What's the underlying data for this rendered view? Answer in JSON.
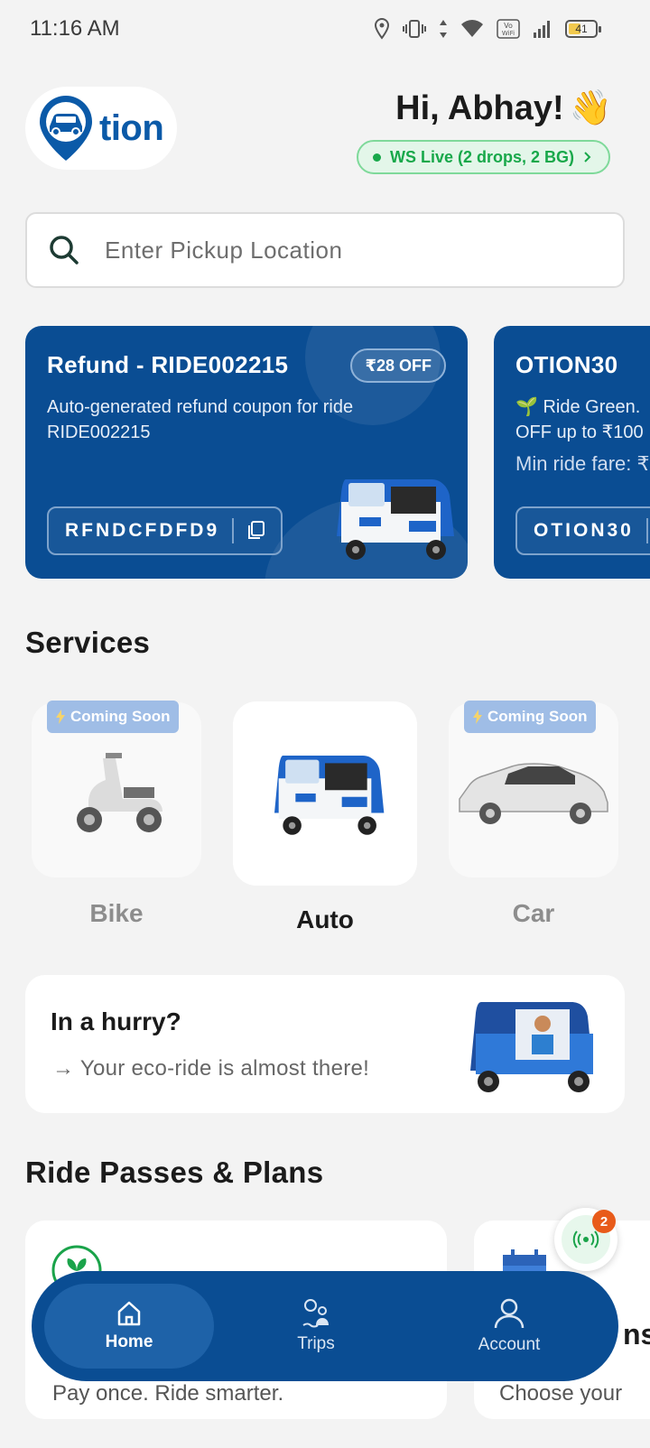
{
  "status_bar": {
    "time": "11:16 AM",
    "battery": "41"
  },
  "header": {
    "logo_text": "tion",
    "greeting": "Hi, Abhay!",
    "greeting_emoji": "👋",
    "ws_status": "WS Live (2 drops, 2 BG)"
  },
  "search": {
    "placeholder": "Enter Pickup Location"
  },
  "coupons": [
    {
      "title": "Refund - RIDE002215",
      "badge": "₹28 OFF",
      "description": "Auto-generated refund coupon for ride RIDE002215",
      "code": "RFNDCFDFD9"
    },
    {
      "title": "OTION30",
      "description": "🌱 Ride Green.",
      "description2": "OFF up to ₹100",
      "min_fare": "Min ride fare: ₹",
      "code": "OTION30"
    }
  ],
  "services": {
    "title": "Services",
    "items": [
      {
        "label": "Bike",
        "badge": "Coming Soon"
      },
      {
        "label": "Auto"
      },
      {
        "label": "Car",
        "badge": "Coming Soon"
      }
    ]
  },
  "hurry": {
    "title": "In a hurry?",
    "arrow": "→",
    "subtitle": "Your eco-ride is almost there!"
  },
  "passes": {
    "title": "Ride Passes & Plans",
    "cards": [
      {
        "subtitle": "Pay once. Ride smarter."
      },
      {
        "title_fragment": "ns",
        "subtitle": "Choose your"
      }
    ]
  },
  "fab": {
    "badge": "2"
  },
  "bottom_nav": [
    {
      "label": "Home",
      "icon": "home-icon",
      "active": true
    },
    {
      "label": "Trips",
      "icon": "trips-icon",
      "active": false
    },
    {
      "label": "Account",
      "icon": "account-icon",
      "active": false
    }
  ],
  "colors": {
    "brand": "#0a4d93",
    "live_green": "#18a84a",
    "badge_orange": "#e85b1a"
  }
}
